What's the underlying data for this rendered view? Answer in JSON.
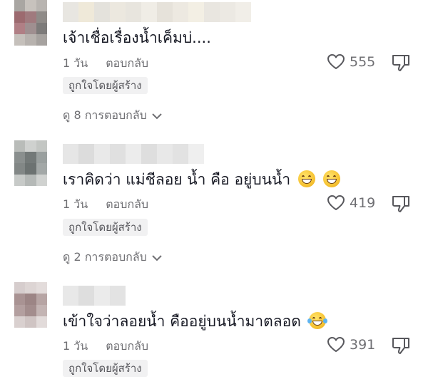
{
  "comments": [
    {
      "text": "เจ้าเชื่อเรื่องน้ำเค็มบ่....",
      "time": "1 วัน",
      "reply_label": "ตอบกลับ",
      "likes": "555",
      "badge": "ถูกใจโดยผู้สร้าง",
      "view_replies": "ดู 8 การตอบกลับ",
      "emoji": []
    },
    {
      "text": "เราคิดว่า แม่ชีลอย น้ำ คือ อยู่บนน้ำ",
      "time": "1 วัน",
      "reply_label": "ตอบกลับ",
      "likes": "419",
      "badge": "ถูกใจโดยผู้สร้าง",
      "view_replies": "ดู 2 การตอบกลับ",
      "emoji": [
        "grinning-face",
        "grinning-face"
      ]
    },
    {
      "text": "เข้าใจว่าลอยน้ำ คืออยู่บนน้ำมาตลอด",
      "time": "1 วัน",
      "reply_label": "ตอบกลับ",
      "likes": "391",
      "badge": "ถูกใจโดยผู้สร้าง",
      "emoji": [
        "face-with-tears-of-joy"
      ]
    }
  ],
  "colors": {
    "text": "#161823",
    "secondary": "#6f6f73",
    "badge_bg": "#f1f1f2"
  }
}
